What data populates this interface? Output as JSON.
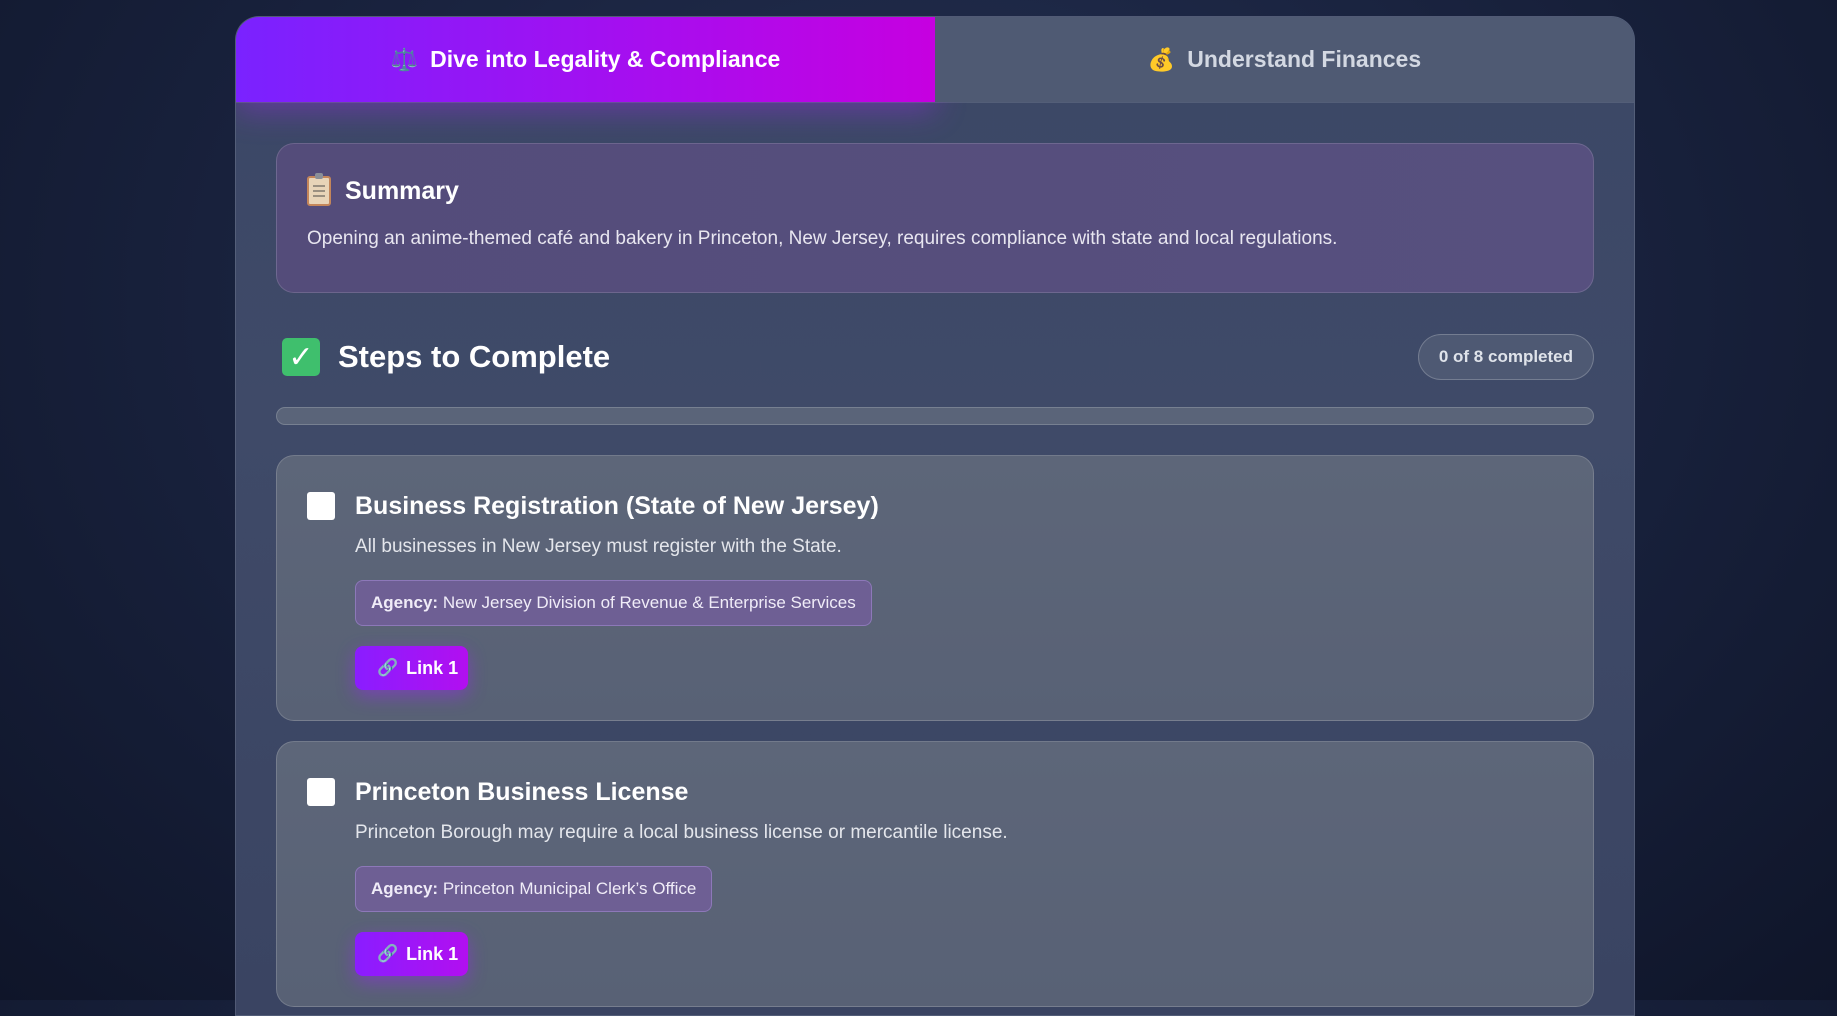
{
  "tabs": [
    {
      "label": "Dive into Legality & Compliance",
      "icon": "⚖️",
      "active": true
    },
    {
      "label": "Understand Finances",
      "icon": "💰",
      "active": false
    }
  ],
  "summary": {
    "title": "Summary",
    "text": "Opening an anime-themed café and bakery in Princeton, New Jersey, requires compliance with state and local regulations."
  },
  "steps": {
    "title": "Steps to Complete",
    "count_label": "0 of 8 completed",
    "completed": 0,
    "total": 8,
    "items": [
      {
        "title": "Business Registration (State of New Jersey)",
        "description": "All businesses in New Jersey must register with the State.",
        "agency_label": "Agency:",
        "agency": "New Jersey Division of Revenue & Enterprise Services",
        "link_label": "Link 1"
      },
      {
        "title": "Princeton Business License",
        "description": "Princeton Borough may require a local business license or mercantile license.",
        "agency_label": "Agency:",
        "agency": "Princeton Municipal Clerk’s Office",
        "link_label": "Link 1"
      }
    ]
  },
  "colors": {
    "accent": "#8a1dff",
    "accent_end": "#c600e0",
    "success": "#3fbf6d"
  }
}
